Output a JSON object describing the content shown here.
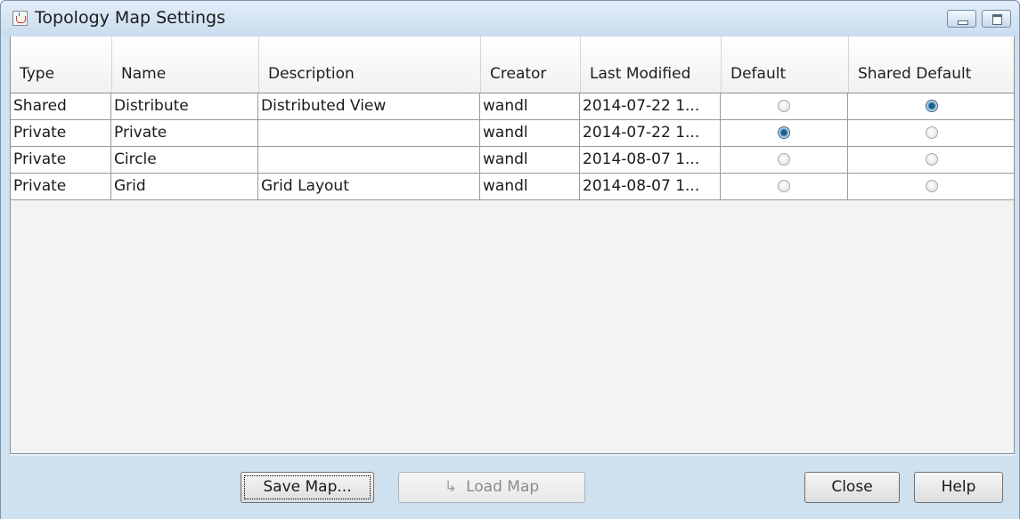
{
  "window": {
    "title": "Topology Map Settings",
    "icon": "java-cup-icon"
  },
  "table": {
    "columns": [
      "Type",
      "Name",
      "Description",
      "Creator",
      "Last Modified",
      "Default",
      "Shared Default"
    ],
    "rows": [
      {
        "type": "Shared",
        "name": "Distribute",
        "description": "Distributed View",
        "creator": "wandl",
        "last_modified": "2014-07-22 1...",
        "default": false,
        "shared_default": true
      },
      {
        "type": "Private",
        "name": "Private",
        "description": "",
        "creator": "wandl",
        "last_modified": "2014-07-22 1...",
        "default": true,
        "shared_default": false
      },
      {
        "type": "Private",
        "name": "Circle",
        "description": "",
        "creator": "wandl",
        "last_modified": "2014-08-07 1...",
        "default": false,
        "shared_default": false
      },
      {
        "type": "Private",
        "name": "Grid",
        "description": "Grid Layout",
        "creator": "wandl",
        "last_modified": "2014-08-07 1...",
        "default": false,
        "shared_default": false
      }
    ]
  },
  "buttons": {
    "save_map": "Save Map...",
    "load_map": "Load Map",
    "close": "Close",
    "help": "Help"
  },
  "colors": {
    "window_frame": "#cfe0ef",
    "radio_selected": "#1b6190"
  }
}
